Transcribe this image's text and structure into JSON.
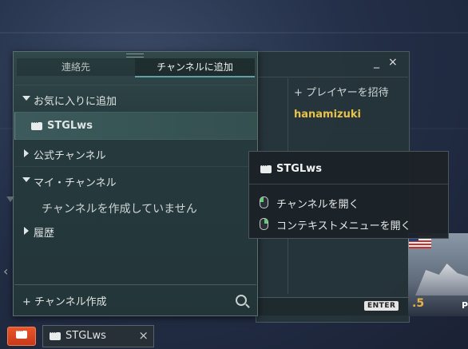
{
  "contacts_window": {
    "tabs": [
      {
        "label": "連絡先",
        "active": false
      },
      {
        "label": "チャンネルに追加",
        "active": true
      }
    ],
    "sections": [
      {
        "label": "お気に入りに追加",
        "expanded": true
      },
      {
        "label": "STGLws",
        "type": "channel",
        "selected": true
      },
      {
        "label": "公式チャンネル",
        "expanded": false
      },
      {
        "label": "マイ・チャンネル",
        "expanded": true
      },
      {
        "label": "チャンネルを作成していません",
        "type": "empty-note"
      },
      {
        "label": "履歴",
        "expanded": false
      }
    ],
    "create_channel_label": "+ チャンネル作成"
  },
  "chat_window": {
    "invite_label": "+ プレイヤーを招待",
    "minimize_label": "_",
    "close_label": "×",
    "player_name": "hanamizuki",
    "enter_key_label": "ENTER"
  },
  "tooltip": {
    "title": "STGLws",
    "actions": [
      {
        "label": "チャンネルを開く",
        "mouse_button": "left"
      },
      {
        "label": "コンテキストメニューを開く",
        "mouse_button": "right"
      }
    ]
  },
  "taskbar": {
    "chat_tab_label": "STGLws",
    "chat_tab_close": "×"
  },
  "ship_card": {
    "tier_label": ".5",
    "name_initial": "P"
  },
  "colors": {
    "accent": "#5fa0a8",
    "player_name": "#e8c24a",
    "notification": "#e8562a",
    "mouse_highlight": "#5ecf78"
  }
}
